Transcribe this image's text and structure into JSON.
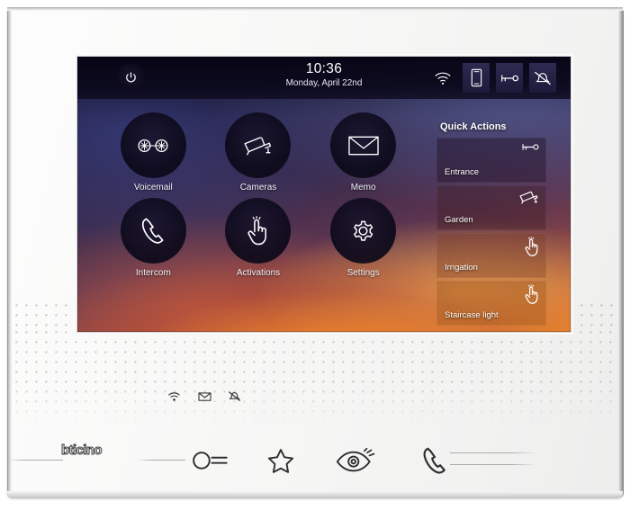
{
  "device": {
    "brand": "bticino",
    "product_name": "video door entry indoor touchscreen"
  },
  "screen": {
    "statusbar": {
      "power_icon": "power-icon",
      "time": "10:36",
      "date": "Monday, April 22nd",
      "icons": [
        {
          "name": "wifi-icon",
          "label": "Wi-Fi",
          "boxed": false
        },
        {
          "name": "smartphone-icon",
          "label": "Smartphone",
          "boxed": true
        },
        {
          "name": "key-icon",
          "label": "Door lock",
          "boxed": true
        },
        {
          "name": "bell-muted-icon",
          "label": "Ringtone muted",
          "boxed": true
        }
      ]
    },
    "apps": [
      {
        "label": "Voicemail",
        "icon": "voicemail-icon"
      },
      {
        "label": "Cameras",
        "icon": "cctv-camera-icon"
      },
      {
        "label": "Memo",
        "icon": "envelope-icon"
      },
      {
        "label": "Intercom",
        "icon": "phone-handset-icon"
      },
      {
        "label": "Activations",
        "icon": "hand-touch-icon"
      },
      {
        "label": "Settings",
        "icon": "gear-icon"
      }
    ],
    "quick_actions": {
      "title": "Quick Actions",
      "items": [
        {
          "label": "Entrance",
          "icon": "key-icon"
        },
        {
          "label": "Garden",
          "icon": "cctv-camera-icon"
        },
        {
          "label": "Irrigation",
          "icon": "hand-touch-icon"
        },
        {
          "label": "Staircase light",
          "icon": "hand-touch-icon"
        }
      ]
    }
  },
  "bezel": {
    "status_leds": [
      {
        "name": "wifi-led-icon",
        "label": "Wi-Fi"
      },
      {
        "name": "envelope-led-icon",
        "label": "New message"
      },
      {
        "name": "bell-muted-led-icon",
        "label": "Muted"
      }
    ],
    "buttons": [
      {
        "name": "door-lock-button",
        "icon": "key-circle-icon",
        "label": "Door lock"
      },
      {
        "name": "favorites-button",
        "icon": "star-icon",
        "label": "Favourites"
      },
      {
        "name": "camera-view-button",
        "icon": "eye-icon",
        "label": "Camera view"
      },
      {
        "name": "call-button",
        "icon": "phone-handset-icon",
        "label": "Call"
      }
    ]
  },
  "colors": {
    "bezel": "#f6f6f5",
    "screen_dark": "#1b1733",
    "screen_warm": "#e9801f",
    "status_bar": "#07051 4",
    "text_light": "#ffffff",
    "icon_stroke": "#ffffff",
    "bezel_icon": "#2e2e2e"
  }
}
